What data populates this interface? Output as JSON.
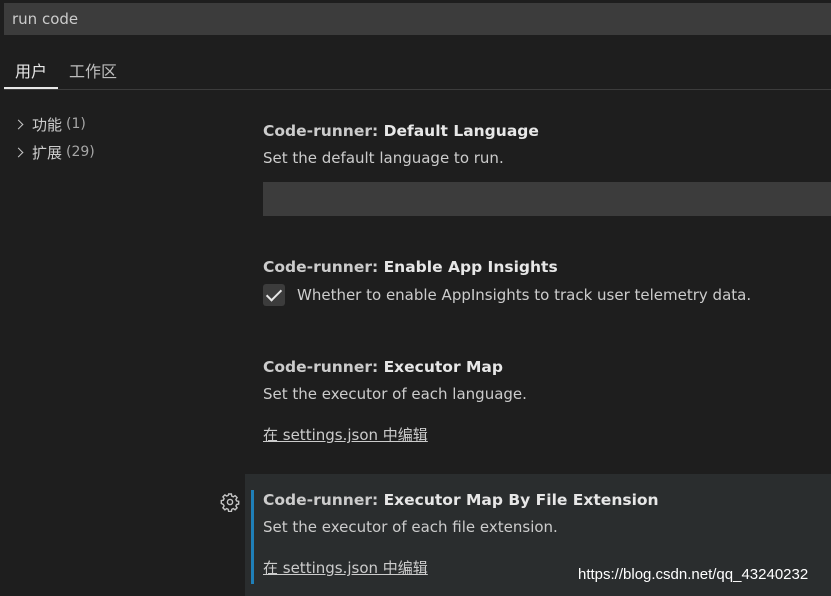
{
  "search": {
    "value": "run code"
  },
  "tabs": [
    {
      "label": "用户",
      "active": true
    },
    {
      "label": "工作区",
      "active": false
    }
  ],
  "tree": {
    "items": [
      {
        "label": "功能",
        "count": "(1)"
      },
      {
        "label": "扩展",
        "count": "(29)"
      }
    ]
  },
  "settings": [
    {
      "category": "Code-runner: ",
      "title": "Default Language",
      "description": "Set the default language to run.",
      "value": ""
    },
    {
      "category": "Code-runner: ",
      "title": "Enable App Insights",
      "checkbox_label": "Whether to enable AppInsights to track user telemetry data.",
      "checked": true
    },
    {
      "category": "Code-runner: ",
      "title": "Executor Map",
      "description": "Set the executor of each language.",
      "link": "在 settings.json 中编辑"
    },
    {
      "category": "Code-runner: ",
      "title": "Executor Map By File Extension",
      "description": "Set the executor of each file extension.",
      "link": "在 settings.json 中编辑"
    }
  ],
  "watermark": "https://blog.csdn.net/qq_43240232",
  "colors": {
    "background": "#1e1e1e",
    "input": "#3c3c3c",
    "focus_accent": "#1f7fb8",
    "text": "#cccccc"
  }
}
